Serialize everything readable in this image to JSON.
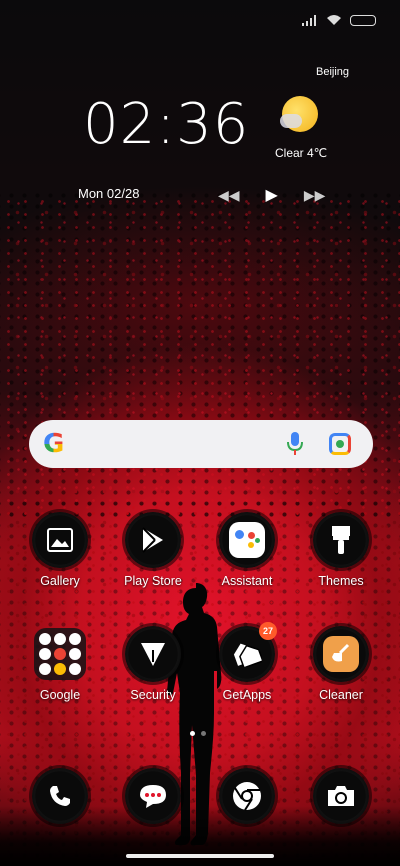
{
  "widget": {
    "time": "02:36",
    "date": "Mon 02/28",
    "city": "Beijing",
    "weather": "Clear  4℃"
  },
  "media": {
    "prev_icon": "rewind-icon",
    "play_icon": "play-icon",
    "next_icon": "fast-forward-icon"
  },
  "search": {
    "logo": "G",
    "mic_icon": "microphone-icon",
    "lens_icon": "google-lens-icon"
  },
  "apps_row1": [
    {
      "label": "Gallery",
      "icon": "gallery-icon"
    },
    {
      "label": "Play Store",
      "icon": "play-store-icon"
    },
    {
      "label": "Assistant",
      "icon": "assistant-icon"
    },
    {
      "label": "Themes",
      "icon": "paintbrush-icon"
    }
  ],
  "apps_row2": [
    {
      "label": "Google",
      "icon": "google-folder-icon"
    },
    {
      "label": "Security",
      "icon": "security-icon"
    },
    {
      "label": "GetApps",
      "icon": "tags-icon",
      "badge": "27"
    },
    {
      "label": "Cleaner",
      "icon": "broom-icon"
    }
  ],
  "dock": [
    {
      "icon": "phone-icon"
    },
    {
      "icon": "messages-icon"
    },
    {
      "icon": "chrome-icon"
    },
    {
      "icon": "camera-icon"
    }
  ],
  "colors": {
    "wallpaper_red": "#c4101f",
    "badge": "#ff5a2a",
    "sun": "#f3b21b"
  }
}
